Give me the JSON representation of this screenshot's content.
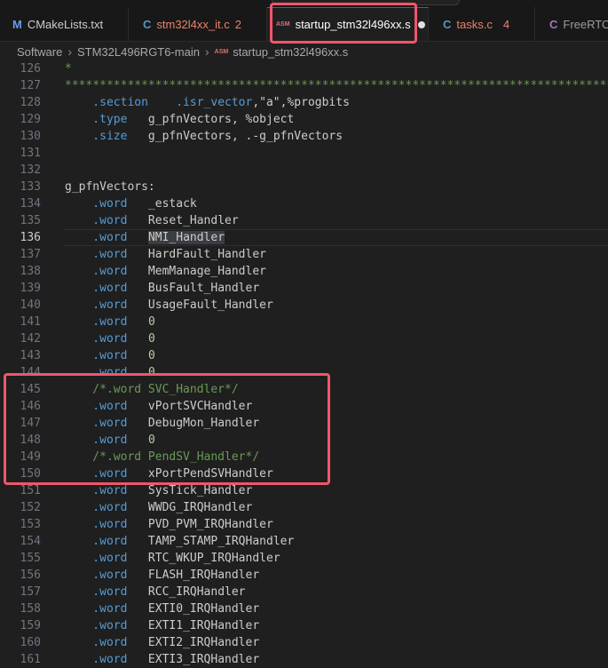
{
  "tabs": [
    {
      "label": "CMakeLists.txt",
      "icon": "M",
      "icon_name": "cmake-icon",
      "icon_color": "#6a9be8",
      "label_color": "#cccccc",
      "count": ""
    },
    {
      "label": "stm32l4xx_it.c",
      "icon": "C",
      "icon_name": "c-file-icon",
      "icon_color": "#519aba",
      "label_color": "#e8836b",
      "count": "2"
    },
    {
      "label": "startup_stm32l496xx.s",
      "icon": "ASM",
      "icon_name": "asm-file-icon",
      "icon_color": "#e06c75",
      "label_color": "#ffffff",
      "count": ""
    },
    {
      "label": "tasks.c",
      "icon": "C",
      "icon_name": "c-file-icon",
      "icon_color": "#519aba",
      "label_color": "#e8836b",
      "count": "4"
    },
    {
      "label": "FreeRTOS",
      "icon": "C",
      "icon_name": "c-file-icon",
      "icon_color": "#a074c4",
      "label_color": "#9d9d9d",
      "count": ""
    }
  ],
  "breadcrumb": [
    "Software",
    "STM32L496RGT6-main",
    "startup_stm32l496xx.s"
  ],
  "breadcrumb_icon": "ASM",
  "current_line": 136,
  "lines": [
    {
      "n": 126,
      "t": [
        {
          "c": "cmt",
          "s": "*"
        }
      ]
    },
    {
      "n": 127,
      "t": [
        {
          "c": "cmt",
          "s": "*****************************************************************************************************"
        }
      ]
    },
    {
      "n": 128,
      "t": [
        {
          "c": "kw",
          "s": "    .section"
        },
        {
          "c": "",
          "s": "    "
        },
        {
          "c": "kw",
          "s": ".isr_vector"
        },
        {
          "c": "",
          "s": ",\"a\",%progbits"
        }
      ]
    },
    {
      "n": 129,
      "t": [
        {
          "c": "kw",
          "s": "    .type"
        },
        {
          "c": "",
          "s": "   g_pfnVectors, %object"
        }
      ]
    },
    {
      "n": 130,
      "t": [
        {
          "c": "kw",
          "s": "    .size"
        },
        {
          "c": "",
          "s": "   g_pfnVectors, .-g_pfnVectors"
        }
      ]
    },
    {
      "n": 131,
      "t": []
    },
    {
      "n": 132,
      "t": []
    },
    {
      "n": 133,
      "t": [
        {
          "c": "",
          "s": "g_pfnVectors:"
        }
      ]
    },
    {
      "n": 134,
      "t": [
        {
          "c": "kw",
          "s": "    .word"
        },
        {
          "c": "",
          "s": "   _estack"
        }
      ]
    },
    {
      "n": 135,
      "t": [
        {
          "c": "kw",
          "s": "    .word"
        },
        {
          "c": "",
          "s": "   Reset_Handler"
        }
      ]
    },
    {
      "n": 136,
      "t": [
        {
          "c": "kw",
          "s": "    .word"
        },
        {
          "c": "",
          "s": "   "
        },
        {
          "c": "sel",
          "s": "NMI_Handler"
        }
      ]
    },
    {
      "n": 137,
      "t": [
        {
          "c": "kw",
          "s": "    .word"
        },
        {
          "c": "",
          "s": "   HardFault_Handler"
        }
      ]
    },
    {
      "n": 138,
      "t": [
        {
          "c": "kw",
          "s": "    .word"
        },
        {
          "c": "",
          "s": "   MemManage_Handler"
        }
      ]
    },
    {
      "n": 139,
      "t": [
        {
          "c": "kw",
          "s": "    .word"
        },
        {
          "c": "",
          "s": "   BusFault_Handler"
        }
      ]
    },
    {
      "n": 140,
      "t": [
        {
          "c": "kw",
          "s": "    .word"
        },
        {
          "c": "",
          "s": "   UsageFault_Handler"
        }
      ]
    },
    {
      "n": 141,
      "t": [
        {
          "c": "kw",
          "s": "    .word"
        },
        {
          "c": "",
          "s": "   "
        },
        {
          "c": "num",
          "s": "0"
        }
      ]
    },
    {
      "n": 142,
      "t": [
        {
          "c": "kw",
          "s": "    .word"
        },
        {
          "c": "",
          "s": "   "
        },
        {
          "c": "num",
          "s": "0"
        }
      ]
    },
    {
      "n": 143,
      "t": [
        {
          "c": "kw",
          "s": "    .word"
        },
        {
          "c": "",
          "s": "   "
        },
        {
          "c": "num",
          "s": "0"
        }
      ]
    },
    {
      "n": 144,
      "t": [
        {
          "c": "kw",
          "s": "    .word"
        },
        {
          "c": "",
          "s": "   "
        },
        {
          "c": "num",
          "s": "0"
        }
      ]
    },
    {
      "n": 145,
      "t": [
        {
          "c": "cmt",
          "s": "    /*.word SVC_Handler*/"
        }
      ]
    },
    {
      "n": 146,
      "t": [
        {
          "c": "kw",
          "s": "    .word"
        },
        {
          "c": "",
          "s": "   vPortSVCHandler"
        }
      ]
    },
    {
      "n": 147,
      "t": [
        {
          "c": "kw",
          "s": "    .word"
        },
        {
          "c": "",
          "s": "   DebugMon_Handler"
        }
      ]
    },
    {
      "n": 148,
      "t": [
        {
          "c": "kw",
          "s": "    .word"
        },
        {
          "c": "",
          "s": "   "
        },
        {
          "c": "num",
          "s": "0"
        }
      ]
    },
    {
      "n": 149,
      "t": [
        {
          "c": "cmt",
          "s": "    /*.word PendSV_Handler*/"
        }
      ]
    },
    {
      "n": 150,
      "t": [
        {
          "c": "kw",
          "s": "    .word"
        },
        {
          "c": "",
          "s": "   xPortPendSVHandler"
        }
      ]
    },
    {
      "n": 151,
      "t": [
        {
          "c": "kw",
          "s": "    .word"
        },
        {
          "c": "",
          "s": "   SysTick_Handler"
        }
      ]
    },
    {
      "n": 152,
      "t": [
        {
          "c": "kw",
          "s": "    .word"
        },
        {
          "c": "",
          "s": "   WWDG_IRQHandler"
        }
      ]
    },
    {
      "n": 153,
      "t": [
        {
          "c": "kw",
          "s": "    .word"
        },
        {
          "c": "",
          "s": "   PVD_PVM_IRQHandler"
        }
      ]
    },
    {
      "n": 154,
      "t": [
        {
          "c": "kw",
          "s": "    .word"
        },
        {
          "c": "",
          "s": "   TAMP_STAMP_IRQHandler"
        }
      ]
    },
    {
      "n": 155,
      "t": [
        {
          "c": "kw",
          "s": "    .word"
        },
        {
          "c": "",
          "s": "   RTC_WKUP_IRQHandler"
        }
      ]
    },
    {
      "n": 156,
      "t": [
        {
          "c": "kw",
          "s": "    .word"
        },
        {
          "c": "",
          "s": "   FLASH_IRQHandler"
        }
      ]
    },
    {
      "n": 157,
      "t": [
        {
          "c": "kw",
          "s": "    .word"
        },
        {
          "c": "",
          "s": "   RCC_IRQHandler"
        }
      ]
    },
    {
      "n": 158,
      "t": [
        {
          "c": "kw",
          "s": "    .word"
        },
        {
          "c": "",
          "s": "   EXTI0_IRQHandler"
        }
      ]
    },
    {
      "n": 159,
      "t": [
        {
          "c": "kw",
          "s": "    .word"
        },
        {
          "c": "",
          "s": "   EXTI1_IRQHandler"
        }
      ]
    },
    {
      "n": 160,
      "t": [
        {
          "c": "kw",
          "s": "    .word"
        },
        {
          "c": "",
          "s": "   EXTI2_IRQHandler"
        }
      ]
    },
    {
      "n": 161,
      "t": [
        {
          "c": "kw",
          "s": "    .word"
        },
        {
          "c": "",
          "s": "   EXTI3_IRQHandler"
        }
      ]
    }
  ],
  "colors": {
    "highlight_box": "#f0566a",
    "keyword": "#569cd6",
    "number": "#b5cea8",
    "comment": "#6a9955"
  }
}
